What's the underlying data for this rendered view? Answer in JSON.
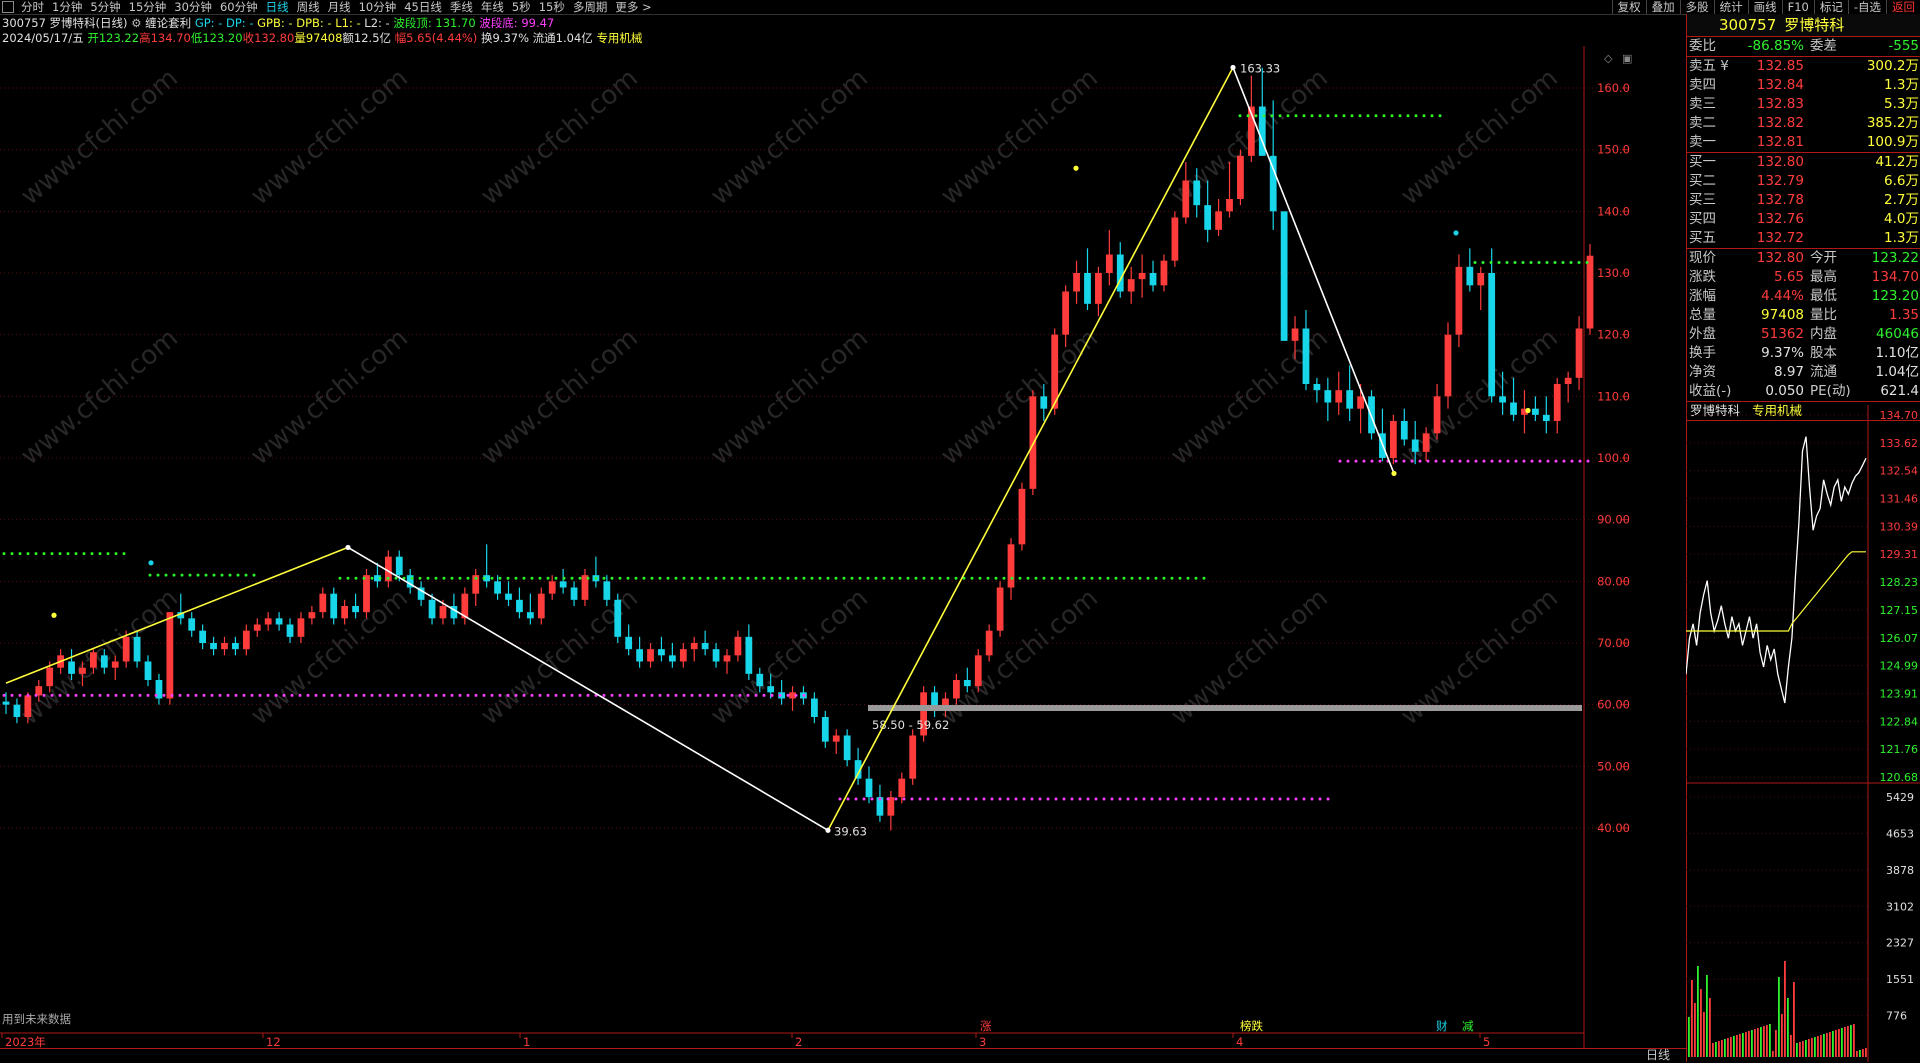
{
  "toolbar": {
    "periods": [
      "分时",
      "1分钟",
      "5分钟",
      "15分钟",
      "30分钟",
      "60分钟",
      "日线",
      "周线",
      "月线",
      "10分钟",
      "45日线",
      "季线",
      "年线",
      "5秒",
      "15秒",
      "多周期",
      "更多 >"
    ],
    "active_period": "日线",
    "tools": [
      "复权",
      "叠加",
      "多股",
      "统计",
      "画线",
      "F10",
      "标记",
      "-自选",
      "返回"
    ]
  },
  "header": {
    "line1": {
      "code_name": "300757 罗博特科(日线)",
      "indicator": "缠论套利",
      "gp": "GP: -",
      "dp": "DP: -",
      "gpb": "GPB: -",
      "dpb": "DPB: -",
      "l1": "L1: -",
      "l2": "L2: -",
      "wave_top_label": "波段顶: ",
      "wave_top_value": "131.70",
      "wave_bottom_label": "波段底: ",
      "wave_bottom_value": "99.47"
    },
    "line2": {
      "date": "2024/05/17/五",
      "open": "开123.22",
      "high": "高134.70",
      "low": "低123.20",
      "close": "收132.80",
      "volume": "量97408",
      "amount": "额12.5亿",
      "amplitude": "幅5.65(4.44%)",
      "turnover": "换9.37%",
      "float": "流通1.04亿",
      "industry": "专用机械"
    }
  },
  "chart_data": {
    "type": "candlestick",
    "y_ticks": [
      "160.0",
      "150.0",
      "140.0",
      "130.0",
      "120.0",
      "110.0",
      "100.0",
      "90.00",
      "80.00",
      "70.00",
      "60.00",
      "50.00",
      "40.00"
    ],
    "ylim": [
      37,
      165
    ],
    "x_labels": [
      "2023年",
      "12",
      "1",
      "2",
      "3",
      "4",
      "5"
    ],
    "annotations": [
      "163.33",
      "39.63",
      "58.50 - 59.62"
    ],
    "markers": [
      "涨",
      "榜跌",
      "财",
      "减"
    ],
    "footnote": "用到未来数据",
    "colors": {
      "up": "#ff3c3c",
      "down": "#18d6ea",
      "upline": "#ffff3a",
      "downline": "#ffffff",
      "support": "#ff40ff",
      "resistance": "#2ef22e"
    }
  },
  "quote": {
    "code": "300757",
    "name": "罗博特科",
    "webi_label": "委比",
    "webi_value": "-86.85%",
    "wecha_label": "委差",
    "wecha_value": "-555",
    "sells": [
      {
        "label": "卖五 ¥",
        "price": "132.85",
        "vol": "300.2万"
      },
      {
        "label": "卖四",
        "price": "132.84",
        "vol": "1.3万"
      },
      {
        "label": "卖三",
        "price": "132.83",
        "vol": "5.3万"
      },
      {
        "label": "卖二",
        "price": "132.82",
        "vol": "385.2万"
      },
      {
        "label": "卖一",
        "price": "132.81",
        "vol": "100.9万"
      }
    ],
    "buys": [
      {
        "label": "买一",
        "price": "132.80",
        "vol": "41.2万"
      },
      {
        "label": "买二",
        "price": "132.79",
        "vol": "6.6万"
      },
      {
        "label": "买三",
        "price": "132.78",
        "vol": "2.7万"
      },
      {
        "label": "买四",
        "price": "132.76",
        "vol": "4.0万"
      },
      {
        "label": "买五",
        "price": "132.72",
        "vol": "1.3万"
      }
    ],
    "stats": [
      {
        "l1": "现价",
        "v1": "132.80",
        "c1": "rd",
        "l2": "今开",
        "v2": "123.22",
        "c2": "gr"
      },
      {
        "l1": "涨跌",
        "v1": "5.65",
        "c1": "rd",
        "l2": "最高",
        "v2": "134.70",
        "c2": "rd"
      },
      {
        "l1": "涨幅",
        "v1": "4.44%",
        "c1": "rd",
        "l2": "最低",
        "v2": "123.20",
        "c2": "gr"
      },
      {
        "l1": "总量",
        "v1": "97408",
        "c1": "yl",
        "l2": "量比",
        "v2": "1.35",
        "c2": "rd"
      },
      {
        "l1": "外盘",
        "v1": "51362",
        "c1": "rd",
        "l2": "内盘",
        "v2": "46046",
        "c2": "gr"
      },
      {
        "l1": "换手",
        "v1": "9.37%",
        "c1": "wh",
        "l2": "股本",
        "v2": "1.10亿",
        "c2": "wh"
      },
      {
        "l1": "净资",
        "v1": "8.97",
        "c1": "wh",
        "l2": "流通",
        "v2": "1.04亿",
        "c2": "wh"
      },
      {
        "l1": "收益(-)",
        "v1": "0.050",
        "c1": "wh",
        "l2": "PE(动)",
        "v2": "621.4",
        "c2": "wh"
      }
    ],
    "mini_name": "罗博特科",
    "mini_industry": "专用机械",
    "mini_price_ticks": [
      "134.70",
      "133.62",
      "132.54",
      "131.46",
      "130.39",
      "129.31",
      "128.23",
      "127.15",
      "126.07",
      "124.99",
      "123.91",
      "122.84",
      "121.76",
      "120.68"
    ],
    "mini_vol_ticks": [
      "5429",
      "4653",
      "3878",
      "3102",
      "2327",
      "1551",
      "776"
    ]
  },
  "bottom": {
    "tab": "日线"
  },
  "watermark": "www.cfchi.com"
}
